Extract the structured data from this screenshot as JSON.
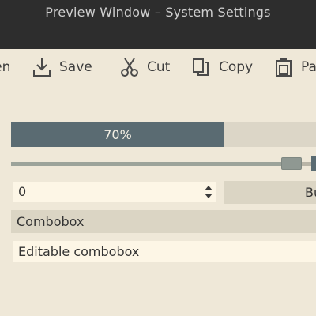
{
  "window": {
    "title": "Preview Window – System Settings"
  },
  "toolbar": {
    "items": [
      {
        "label": "Open",
        "icon": "open-icon"
      },
      {
        "label": "Save",
        "icon": "save-icon"
      },
      {
        "label": "Cut",
        "icon": "cut-icon"
      },
      {
        "label": "Copy",
        "icon": "copy-icon"
      },
      {
        "label": "Paste",
        "icon": "paste-icon"
      }
    ]
  },
  "progress": {
    "value": 70,
    "text": "70%"
  },
  "slider": {
    "value": 0.92
  },
  "spinbox": {
    "value": "0"
  },
  "button": {
    "label": "Button"
  },
  "combobox": {
    "value": "Combobox"
  },
  "editable_combobox": {
    "value": "Editable combobox"
  },
  "colors": {
    "accent": "#5a6b72",
    "background": "#efe8d8",
    "titlebar": "#2d2d2d",
    "field": "#fdf6e6",
    "control": "#dbd5c4"
  }
}
